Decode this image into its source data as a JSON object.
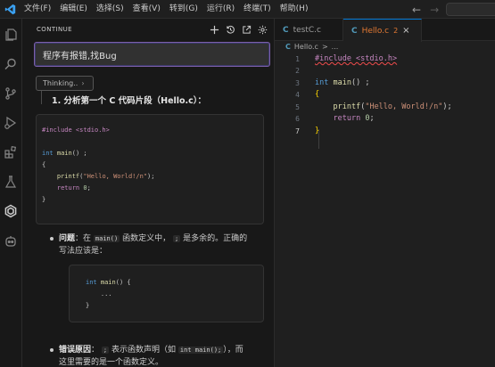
{
  "menu": [
    "文件(F)",
    "编辑(E)",
    "选择(S)",
    "查看(V)",
    "转到(G)",
    "运行(R)",
    "终端(T)",
    "帮助(H)"
  ],
  "nav": {
    "back": "←",
    "forward": "→"
  },
  "panel": {
    "title": "CONTINUE",
    "input_text": "程序有报错,找Bug",
    "thinking_label": "Thinking..",
    "heading": "1. 分析第一个 C 代码片段（Hello.c）：",
    "code1": [
      "#include <stdio.h>",
      "",
      "int main() ;",
      "{",
      "    printf(\"Hello, World!/n\");",
      "    return 0;",
      "}"
    ],
    "bullet1": {
      "label": "问题",
      "text_a": "：在",
      "code": "main()",
      "text_b": "函数定义中，",
      "semicolon": ";",
      "text_c": "是多余的。正确的",
      "line2": "写法应该是："
    },
    "code2": [
      "int main() {",
      "    ...",
      "}"
    ],
    "bullet2": {
      "label": "错误原因",
      "text_a": "：",
      "semicolon": ";",
      "text_b": "表示函数声明（如",
      "code": "int main();",
      "text_c": "），而",
      "line2": "这里需要的是一个函数定义。"
    }
  },
  "editor": {
    "tabs": [
      {
        "label": "testC.c",
        "icon": "C"
      },
      {
        "label": "Hello.c",
        "icon": "C",
        "badge": "2",
        "close": "×"
      }
    ],
    "breadcrumb": {
      "file": "Hello.c",
      "sep": ">",
      "rest": "..."
    },
    "line_numbers": [
      "1",
      "2",
      "3",
      "4",
      "5",
      "6",
      "7"
    ],
    "lines": [
      "#include <stdio.h>",
      "",
      "int main() ;",
      "{",
      "    printf(\"Hello, World!/n\");",
      "    return 0;",
      "}"
    ]
  },
  "colors": {
    "accent": "#0078d4",
    "error": "#e37933",
    "keyword": "#569cd6",
    "string": "#ce9178"
  },
  "icons": [
    "explorer-icon",
    "search-icon",
    "source-control-icon",
    "run-debug-icon",
    "extensions-icon",
    "testing-icon",
    "continue-icon",
    "copilot-icon"
  ]
}
